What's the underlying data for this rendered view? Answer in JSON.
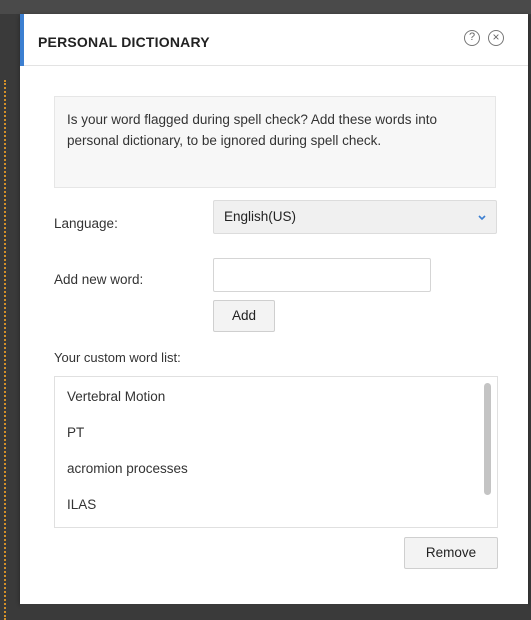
{
  "dialog": {
    "title": "PERSONAL DICTIONARY",
    "help_icon": "?",
    "close_icon": "×",
    "info_text": "Is your word flagged during spell check? Add these words into personal dictionary, to be ignored during spell check.",
    "language_label": "Language:",
    "language_value": "English(US)",
    "add_word_label": "Add new word:",
    "add_word_value": "",
    "add_button": "Add",
    "list_heading": "Your custom word list:",
    "words": [
      "Vertebral Motion",
      "PT",
      "acromion processes",
      "ILAS"
    ],
    "remove_button": "Remove"
  },
  "colors": {
    "accent": "#3c7fd1",
    "guide": "#d4912a"
  },
  "icons": [
    "help-icon",
    "close-icon",
    "chevron-down-icon"
  ]
}
